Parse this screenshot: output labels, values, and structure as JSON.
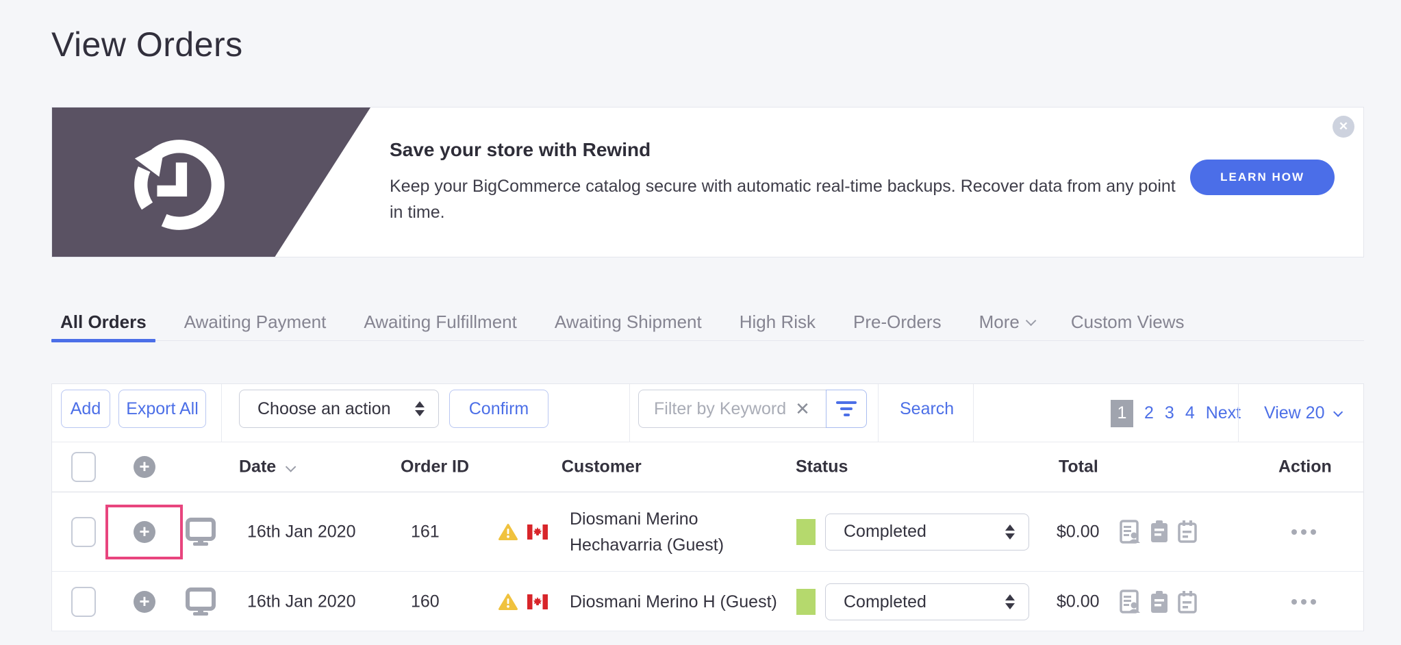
{
  "page": {
    "title": "View Orders"
  },
  "banner": {
    "heading": "Save your store with Rewind",
    "description": "Keep your BigCommerce catalog secure with automatic real-time backups. Recover data from any point in time.",
    "cta_label": "LEARN HOW",
    "close_glyph": "✕"
  },
  "tabs": [
    {
      "label": "All Orders",
      "active": true
    },
    {
      "label": "Awaiting Payment",
      "active": false
    },
    {
      "label": "Awaiting Fulfillment",
      "active": false
    },
    {
      "label": "Awaiting Shipment",
      "active": false
    },
    {
      "label": "High Risk",
      "active": false
    },
    {
      "label": "Pre-Orders",
      "active": false
    },
    {
      "label": "More",
      "active": false,
      "dropdown": true
    },
    {
      "label": "Custom Views",
      "active": false
    }
  ],
  "toolbar": {
    "add_label": "Add",
    "export_label": "Export All",
    "action_select_value": "Choose an action",
    "confirm_label": "Confirm",
    "filter_placeholder": "Filter by Keyword",
    "clear_glyph": "✕",
    "search_label": "Search",
    "pagination": {
      "current": "1",
      "page2": "2",
      "page3": "3",
      "page4": "4",
      "next_label": "Next"
    },
    "view_label": "View 20"
  },
  "table": {
    "headers": {
      "date": "Date",
      "order_id": "Order ID",
      "customer": "Customer",
      "status": "Status",
      "total": "Total",
      "action": "Action"
    },
    "rows": [
      {
        "date": "16th Jan 2020",
        "order_id": "161",
        "customer": "Diosmani Merino Hechavarria (Guest)",
        "status_value": "Completed",
        "total": "$0.00"
      },
      {
        "date": "16th Jan 2020",
        "order_id": "160",
        "customer": "Diosmani Merino H (Guest)",
        "status_value": "Completed",
        "total": "$0.00"
      }
    ]
  },
  "colors": {
    "accent_blue": "#4c6fe7",
    "brand_purple": "#5a5263",
    "status_green": "#b5d96d",
    "highlight_pink": "#e8457e",
    "warning_yellow": "#f0c23e"
  }
}
